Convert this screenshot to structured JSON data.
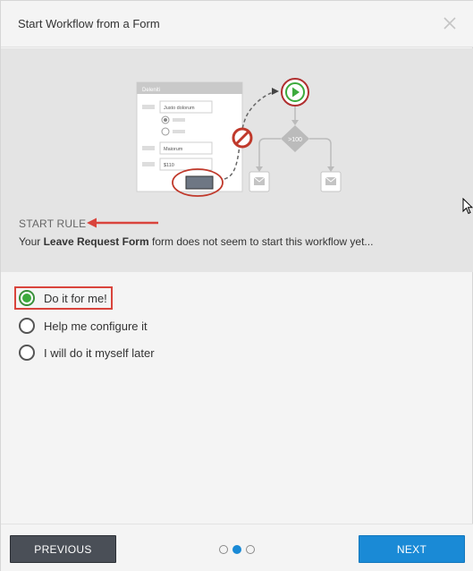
{
  "dialog": {
    "title": "Start Workflow from a Form"
  },
  "illustration": {
    "form_title": "Deleniti",
    "field_1": "Justo dolorum",
    "field_2": "Maiorum",
    "field_3": "$110",
    "condition_label": ">100"
  },
  "start_rule": {
    "label": "START RULE",
    "message_prefix": "Your",
    "form_name": "Leave Request Form",
    "message_suffix": "form does not seem to start this workflow yet..."
  },
  "options": [
    {
      "label": "Do it for me!",
      "selected": true
    },
    {
      "label": "Help me configure it",
      "selected": false
    },
    {
      "label": "I will do it myself later",
      "selected": false
    }
  ],
  "footer": {
    "previous_label": "PREVIOUS",
    "next_label": "NEXT",
    "current_page": 2,
    "total_pages": 3
  },
  "colors": {
    "accent": "#1a8ad6",
    "selected_radio": "#3caa3c",
    "highlight": "#d9443c"
  }
}
